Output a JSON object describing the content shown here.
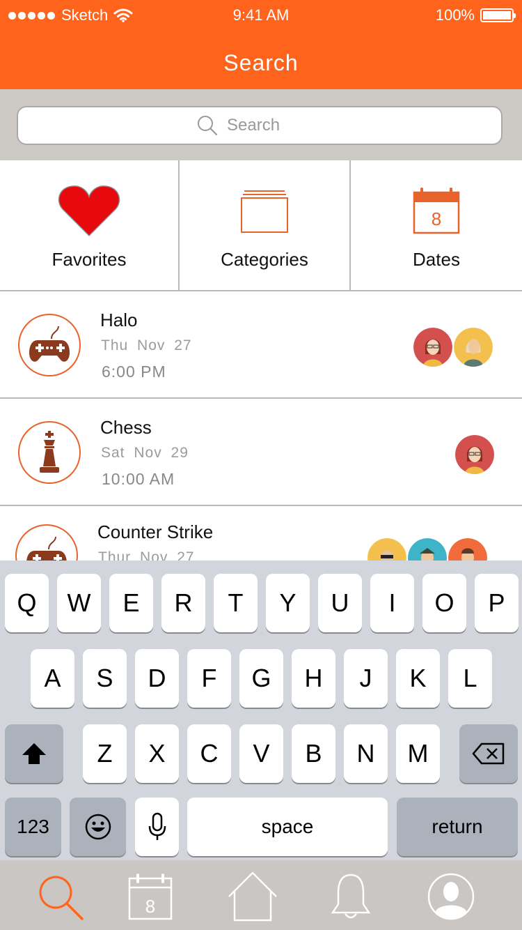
{
  "status_bar": {
    "carrier": "Sketch",
    "time": "9:41 AM",
    "battery": "100%"
  },
  "nav": {
    "title": "Search"
  },
  "search": {
    "placeholder": "Search",
    "value": ""
  },
  "quick_actions": [
    {
      "label": "Favorites",
      "icon": "heart-icon"
    },
    {
      "label": "Categories",
      "icon": "folder-stack-icon"
    },
    {
      "label": "Dates",
      "icon": "calendar-icon",
      "calendar_day": "8"
    }
  ],
  "events": [
    {
      "title": "Halo",
      "day": "Thu",
      "date": "Nov 27",
      "time": "6:00 PM",
      "icon": "gamepad-icon"
    },
    {
      "title": "Chess",
      "day": "Sat",
      "date": "Nov 29",
      "time": "10:00 AM",
      "icon": "chess-king-icon"
    },
    {
      "title": "Counter Strike",
      "day": "Thur",
      "date": "Nov 27",
      "time": "",
      "icon": "gamepad-icon"
    }
  ],
  "keyboard": {
    "row1": [
      "Q",
      "W",
      "E",
      "R",
      "T",
      "Y",
      "U",
      "I",
      "O",
      "P"
    ],
    "row2": [
      "A",
      "S",
      "D",
      "F",
      "G",
      "H",
      "J",
      "K",
      "L"
    ],
    "row3": [
      "Z",
      "X",
      "C",
      "V",
      "B",
      "N",
      "M"
    ],
    "numbers_label": "123",
    "space_label": "space",
    "return_label": "return"
  },
  "tabbar": {
    "tabs": [
      "search-icon",
      "calendar-icon",
      "home-icon",
      "bell-icon",
      "profile-icon"
    ],
    "calendar_day": "8",
    "active_color": "#FF631C"
  },
  "colors": {
    "accent": "#FF631C",
    "icon_brown": "#8B3A1E",
    "heart": "#E8090F",
    "separator": "#B8B8B8"
  }
}
